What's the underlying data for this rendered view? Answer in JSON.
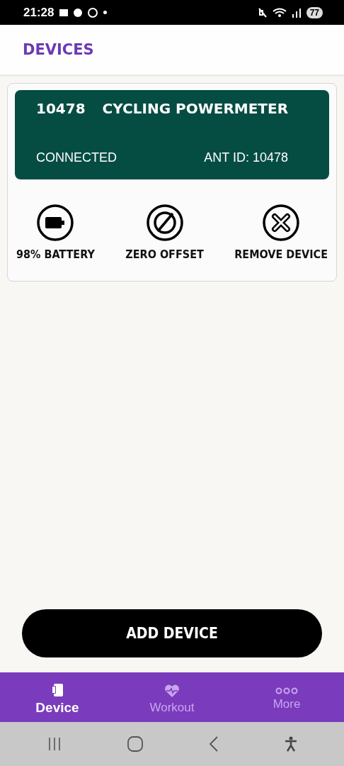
{
  "status_bar": {
    "time": "21:28",
    "battery": "77"
  },
  "header": {
    "title": "DEVICES"
  },
  "device": {
    "number": "10478",
    "name": "CYCLING POWERMETER",
    "status": "CONNECTED",
    "ant_id": "ANT ID: 10478",
    "actions": [
      {
        "kind": "battery",
        "label": "98% BATTERY"
      },
      {
        "kind": "zero",
        "label": "ZERO OFFSET"
      },
      {
        "kind": "remove",
        "label": "REMOVE DEVICE"
      }
    ]
  },
  "add_button": "ADD DEVICE",
  "tabs": [
    {
      "kind": "device",
      "label": "Device",
      "selected": true
    },
    {
      "kind": "workout",
      "label": "Workout",
      "selected": false
    },
    {
      "kind": "more",
      "label": "More",
      "selected": false
    }
  ]
}
